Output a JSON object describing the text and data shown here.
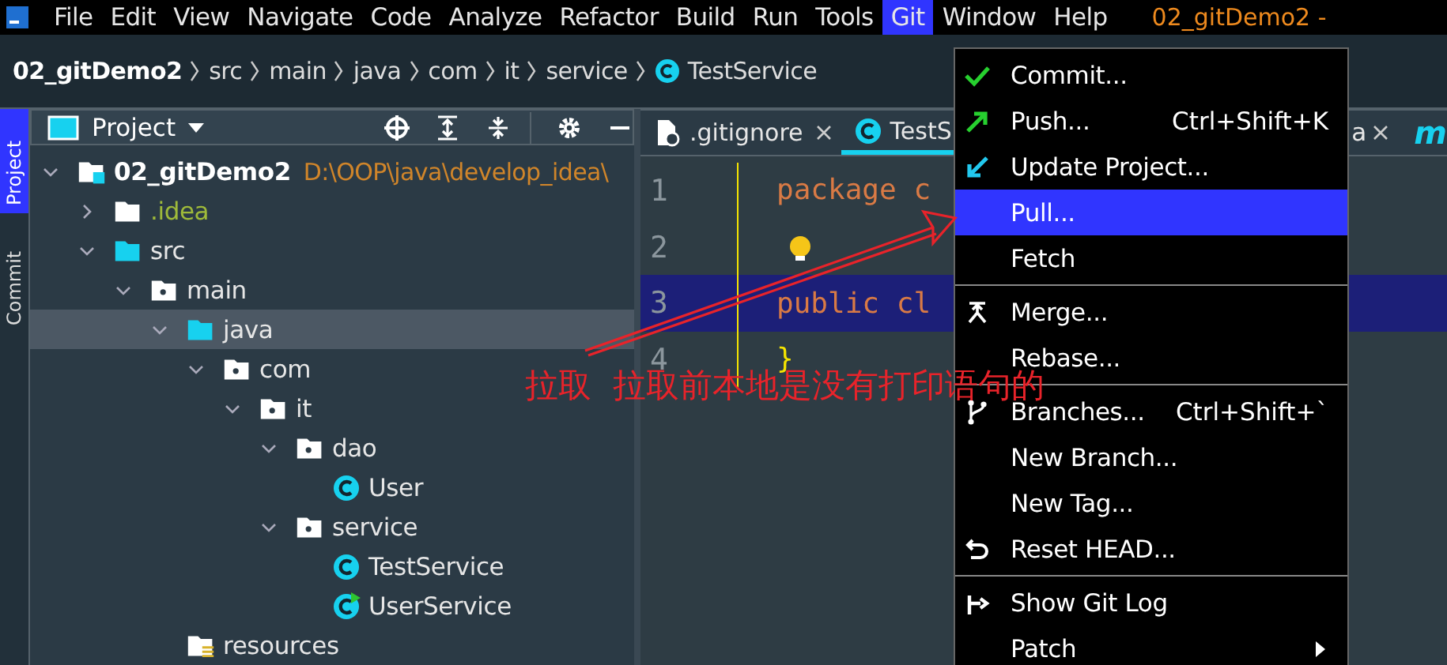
{
  "menu_bar": {
    "items": [
      {
        "label": "File",
        "selected": false
      },
      {
        "label": "Edit",
        "selected": false
      },
      {
        "label": "View",
        "selected": false
      },
      {
        "label": "Navigate",
        "selected": false
      },
      {
        "label": "Code",
        "selected": false
      },
      {
        "label": "Analyze",
        "selected": false
      },
      {
        "label": "Refactor",
        "selected": false
      },
      {
        "label": "Build",
        "selected": false
      },
      {
        "label": "Run",
        "selected": false
      },
      {
        "label": "Tools",
        "selected": false
      },
      {
        "label": "Git",
        "selected": true
      },
      {
        "label": "Window",
        "selected": false
      },
      {
        "label": "Help",
        "selected": false
      }
    ],
    "title": "02_gitDemo2 -"
  },
  "breadcrumb": [
    {
      "label": "02_gitDemo2",
      "kind": "project"
    },
    {
      "label": "src",
      "kind": "folder"
    },
    {
      "label": "main",
      "kind": "folder"
    },
    {
      "label": "java",
      "kind": "folder"
    },
    {
      "label": "com",
      "kind": "folder"
    },
    {
      "label": "it",
      "kind": "folder"
    },
    {
      "label": "service",
      "kind": "folder"
    },
    {
      "label": "TestService",
      "kind": "class"
    }
  ],
  "side_strip": [
    {
      "label": "Project",
      "selected": true
    },
    {
      "label": "Commit",
      "selected": false
    }
  ],
  "project_panel": {
    "title": "Project",
    "tree": [
      {
        "label": "02_gitDemo2",
        "path": "D:\\OOP\\java\\develop_idea\\",
        "kind": "module",
        "expanded": true,
        "selected": false,
        "children": [
          {
            "label": ".idea",
            "kind": "folder",
            "expanded": false,
            "selected": false
          },
          {
            "label": "src",
            "kind": "source",
            "expanded": true,
            "selected": false,
            "children": [
              {
                "label": "main",
                "kind": "package",
                "expanded": true,
                "selected": false,
                "children": [
                  {
                    "label": "java",
                    "kind": "source",
                    "expanded": true,
                    "selected": true,
                    "children": [
                      {
                        "label": "com",
                        "kind": "package",
                        "expanded": true,
                        "selected": false,
                        "children": [
                          {
                            "label": "it",
                            "kind": "package",
                            "expanded": true,
                            "selected": false,
                            "children": [
                              {
                                "label": "dao",
                                "kind": "package",
                                "expanded": true,
                                "selected": false,
                                "children": [
                                  {
                                    "label": "User",
                                    "kind": "class",
                                    "selected": false
                                  }
                                ]
                              },
                              {
                                "label": "service",
                                "kind": "package",
                                "expanded": true,
                                "selected": false,
                                "children": [
                                  {
                                    "label": "TestService",
                                    "kind": "class",
                                    "selected": false
                                  },
                                  {
                                    "label": "UserService",
                                    "kind": "main-class",
                                    "selected": false
                                  }
                                ]
                              }
                            ]
                          }
                        ]
                      }
                    ]
                  },
                  {
                    "label": "resources",
                    "kind": "resources",
                    "selected": false
                  }
                ]
              }
            ]
          }
        ]
      }
    ]
  },
  "editor": {
    "tabs": [
      {
        "label": ".gitignore",
        "kind": "ignore",
        "selected": false
      },
      {
        "label": "TestS",
        "kind": "class",
        "selected": true
      }
    ],
    "right_tab_fragment": "a",
    "right_label": "m",
    "lines": [
      {
        "number": "1",
        "code": "package c",
        "kind": "keyword",
        "current": false
      },
      {
        "number": "2",
        "kind": "bulb",
        "current": false
      },
      {
        "number": "3",
        "code": "public cl",
        "kind": "keyword",
        "current": true
      },
      {
        "number": "4",
        "code": "}",
        "kind": "brace",
        "current": false
      }
    ]
  },
  "git_menu": {
    "groups": [
      [
        {
          "label": "Commit...",
          "kind": "check",
          "selected": false
        },
        {
          "label": "Push...",
          "kind": "push",
          "shortcut": "Ctrl+Shift+K",
          "selected": false
        },
        {
          "label": "Update Project...",
          "kind": "update",
          "selected": false
        },
        {
          "label": "Pull...",
          "kind": "plain",
          "selected": true
        },
        {
          "label": "Fetch",
          "kind": "plain",
          "selected": false
        }
      ],
      [
        {
          "label": "Merge...",
          "kind": "merge",
          "selected": false
        },
        {
          "label": "Rebase...",
          "kind": "plain",
          "selected": false
        }
      ],
      [
        {
          "label": "Branches...",
          "kind": "branch",
          "shortcut": "Ctrl+Shift+`",
          "selected": false
        },
        {
          "label": "New Branch...",
          "kind": "plain",
          "selected": false
        },
        {
          "label": "New Tag...",
          "kind": "plain",
          "selected": false
        },
        {
          "label": "Reset HEAD...",
          "kind": "reset",
          "selected": false
        }
      ],
      [
        {
          "label": "Show Git Log",
          "kind": "log",
          "selected": false
        },
        {
          "label": "Patch",
          "kind": "plain",
          "submenu": true,
          "selected": false
        }
      ]
    ]
  },
  "annotation": {
    "text": "拉取  拉取前本地是没有打印语句的"
  }
}
